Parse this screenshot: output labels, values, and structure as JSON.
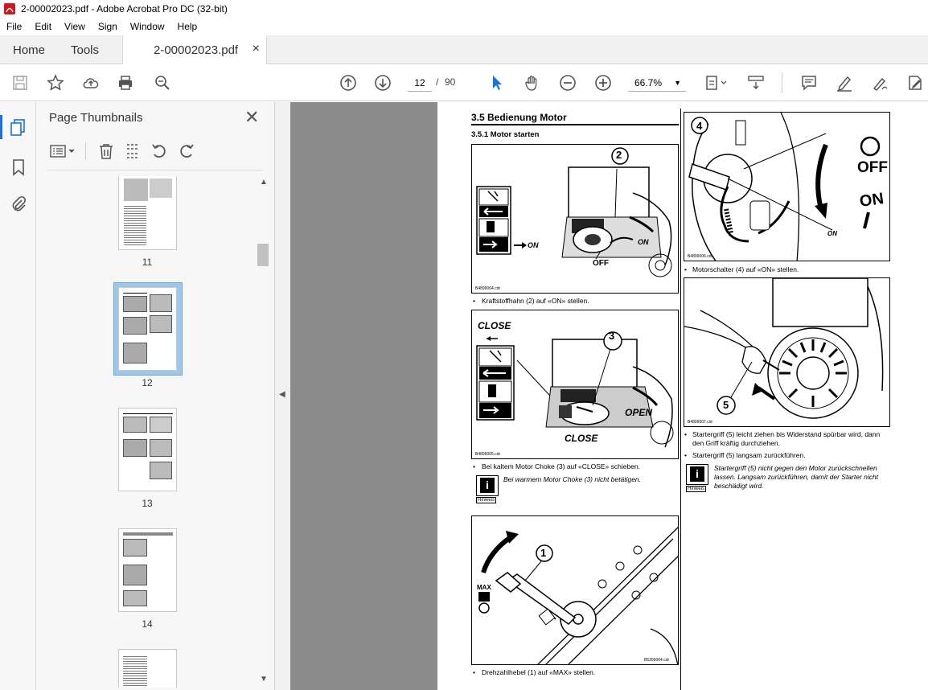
{
  "window": {
    "title": "2-00002023.pdf - Adobe Acrobat Pro DC (32-bit)"
  },
  "menu": [
    "File",
    "Edit",
    "View",
    "Sign",
    "Window",
    "Help"
  ],
  "tabs": {
    "home": "Home",
    "tools": "Tools",
    "doc": "2-00002023.pdf",
    "close": "×"
  },
  "toolbar": {
    "page_current": "12",
    "page_sep": "/",
    "page_total": "90",
    "zoom": "66.7%"
  },
  "panel": {
    "title": "Page Thumbnails",
    "thumbnails": [
      {
        "number": "11",
        "selected": false
      },
      {
        "number": "12",
        "selected": true
      },
      {
        "number": "13",
        "selected": false
      },
      {
        "number": "14",
        "selected": false
      }
    ]
  },
  "document": {
    "heading": "3.5  Bedienung Motor",
    "subheading": "3.5.1  Motor starten",
    "fig2": {
      "callout": "2",
      "label_on": "ON",
      "label_on2": "ON",
      "label_off": "OFF",
      "code": "B4899004.cdr"
    },
    "fig3": {
      "callout": "3",
      "label_close_top": "CLOSE",
      "label_open": "OPEN",
      "label_close": "CLOSE",
      "code": "B4899005.cdr"
    },
    "fig1": {
      "callout": "1",
      "label_max": "MAX",
      "code": "B5399004.cdr"
    },
    "fig4": {
      "callout": "4",
      "label_off": "OFF",
      "label_on": "ON",
      "label_on_small": "ON",
      "code": "B4899006.cdr"
    },
    "fig5": {
      "callout": "5",
      "code": "B4899007.cdr"
    },
    "caption_fig2": "Kraftstoffhahn (2) auf «ON» stellen.",
    "caption_fig3": "Bei kaltem Motor Choke (3) auf «CLOSE» schieben.",
    "note_fig3": "Bei warmem Motor Choke (3) nicht betätigen.",
    "caption_fig1": "Drehzahlhebel (1) auf «MAX» stellen.",
    "caption_fig4": "Motorschalter (4) auf «ON» stellen.",
    "caption_fig5a": "Startergriff (5) leicht ziehen bis Widerstand spürbar wird, dann",
    "caption_fig5b": "den Griff kräftig durchziehen.",
    "caption_fig5c": "Startergriff (5) langsam zurückführen.",
    "note_fig5a": "Startergriff (5) nicht gegen den Motor zurückschnellen",
    "note_fig5b": "lassen. Langsam zurückführen, damit der Starter nicht",
    "note_fig5c": "beschädigt wird.",
    "hinweis": "Hinweis",
    "info_glyph": "i",
    "bullet": "•"
  },
  "colors": {
    "accent": "#1473e6",
    "selected_thumb": "#9fc8e8",
    "doc_bg": "#8b8b8b"
  }
}
